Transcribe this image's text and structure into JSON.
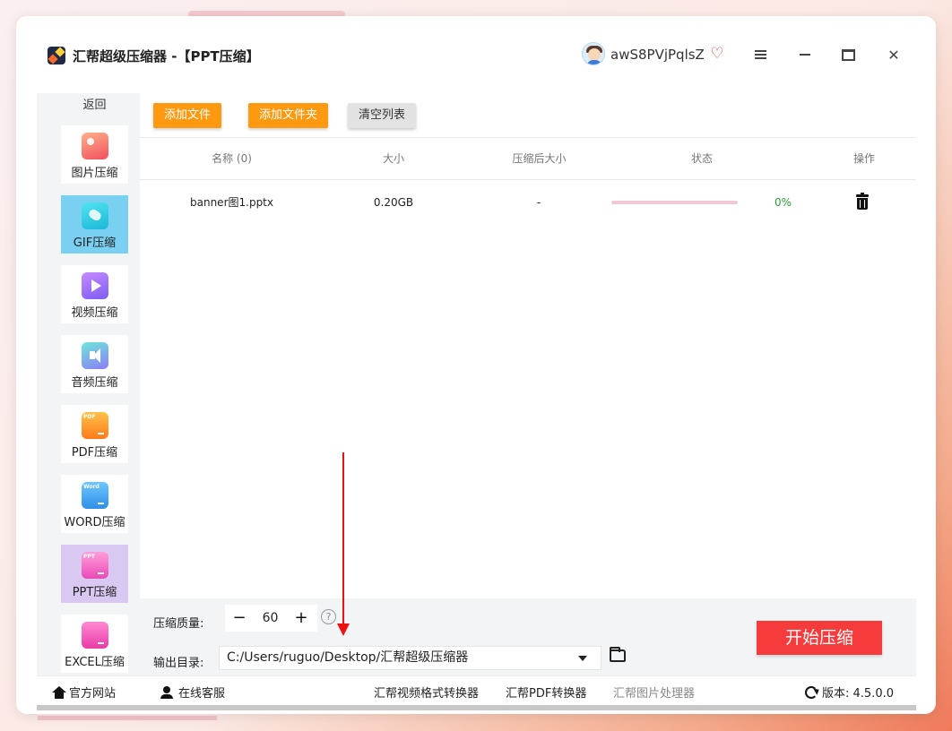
{
  "colors": {
    "accent_orange": "#ff9a10",
    "start_red": "#f53b3b",
    "progress_pink": "#f0c9d2",
    "percent_green": "#2e9d3a",
    "active_gif": "#7ad0f0",
    "active_ppt": "#d9c8f2"
  },
  "titlebar": {
    "app_name": "汇帮超级压缩器 -【PPT压缩】",
    "username": "awS8PVjPqlsZ",
    "icons": [
      "app-logo-icon",
      "user-avatar",
      "vip-heart-icon",
      "menu-icon",
      "minimize-icon",
      "maximize-icon",
      "close-icon"
    ]
  },
  "sidebar": {
    "back_label": "返回",
    "items": [
      {
        "label": "图片压缩",
        "icon": "image-icon"
      },
      {
        "label": "GIF压缩",
        "icon": "gif-icon",
        "active": true
      },
      {
        "label": "视频压缩",
        "icon": "video-icon"
      },
      {
        "label": "音频压缩",
        "icon": "audio-icon"
      },
      {
        "label": "PDF压缩",
        "icon": "pdf-folder-icon",
        "tag": "PDF"
      },
      {
        "label": "WORD压缩",
        "icon": "word-folder-icon",
        "tag": "Word"
      },
      {
        "label": "PPT压缩",
        "icon": "ppt-folder-icon",
        "tag": "PPT",
        "active": true
      },
      {
        "label": "EXCEL压缩",
        "icon": "excel-folder-icon",
        "tag": ""
      }
    ]
  },
  "toolbar": {
    "add_file": "添加文件",
    "add_folder": "添加文件夹",
    "clear_list": "清空列表"
  },
  "table": {
    "columns": [
      "名称 (0)",
      "大小",
      "压缩后大小",
      "状态",
      "操作"
    ],
    "rows": [
      {
        "name": "banner图1.pptx",
        "size": "0.20GB",
        "compressed_size": "-",
        "progress": 0,
        "percent": "0%"
      }
    ]
  },
  "settings": {
    "quality_label": "压缩质量:",
    "quality_value": "60",
    "quality_minus": "−",
    "quality_plus": "+",
    "help": "?",
    "output_label": "输出目录:",
    "output_path": "C:/Users/ruguo/Desktop/汇帮超级压缩器",
    "start_button": "开始压缩"
  },
  "footer": {
    "website": "官方网站",
    "support": "在线客服",
    "link_video": "汇帮视频格式转换器",
    "link_pdf": "汇帮PDF转换器",
    "link_image": "汇帮图片处理器",
    "version": "版本:  4.5.0.0"
  }
}
